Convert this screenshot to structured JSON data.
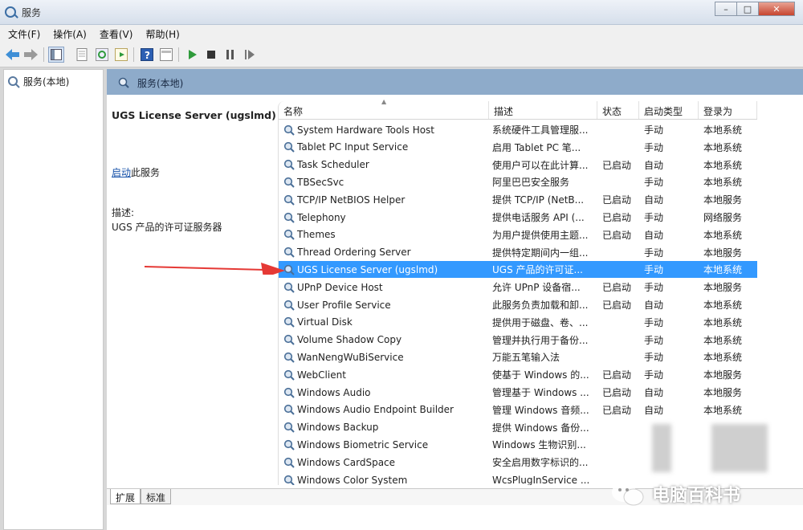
{
  "window": {
    "title": "服务"
  },
  "menu": [
    "文件(F)",
    "操作(A)",
    "查看(V)",
    "帮助(H)"
  ],
  "tree": {
    "root_label": "服务(本地)"
  },
  "panel": {
    "header": "服务(本地)"
  },
  "detail": {
    "service_name": "UGS License Server (ugslmd)",
    "start_link": "启动",
    "start_suffix": "此服务",
    "desc_label": "描述:",
    "desc_value": "UGS 产品的许可证服务器"
  },
  "columns": [
    "名称",
    "描述",
    "状态",
    "启动类型",
    "登录为"
  ],
  "services": [
    {
      "name": "System Hardware Tools Host",
      "desc": "系统硬件工具管理服...",
      "status": "",
      "startup": "手动",
      "logon": "本地系统"
    },
    {
      "name": "Tablet PC Input Service",
      "desc": "启用 Tablet PC 笔...",
      "status": "",
      "startup": "手动",
      "logon": "本地系统"
    },
    {
      "name": "Task Scheduler",
      "desc": "使用户可以在此计算...",
      "status": "已启动",
      "startup": "自动",
      "logon": "本地系统"
    },
    {
      "name": "TBSecSvc",
      "desc": "阿里巴巴安全服务",
      "status": "",
      "startup": "手动",
      "logon": "本地系统"
    },
    {
      "name": "TCP/IP NetBIOS Helper",
      "desc": "提供 TCP/IP (NetB...",
      "status": "已启动",
      "startup": "自动",
      "logon": "本地服务"
    },
    {
      "name": "Telephony",
      "desc": "提供电话服务 API (...",
      "status": "已启动",
      "startup": "手动",
      "logon": "网络服务"
    },
    {
      "name": "Themes",
      "desc": "为用户提供使用主题...",
      "status": "已启动",
      "startup": "自动",
      "logon": "本地系统"
    },
    {
      "name": "Thread Ordering Server",
      "desc": "提供特定期间内一组...",
      "status": "",
      "startup": "手动",
      "logon": "本地服务"
    },
    {
      "name": "UGS License Server (ugslmd)",
      "desc": "UGS 产品的许可证...",
      "status": "",
      "startup": "手动",
      "logon": "本地系统",
      "selected": true
    },
    {
      "name": "UPnP Device Host",
      "desc": "允许 UPnP 设备宿...",
      "status": "已启动",
      "startup": "手动",
      "logon": "本地服务"
    },
    {
      "name": "User Profile Service",
      "desc": "此服务负责加载和卸...",
      "status": "已启动",
      "startup": "自动",
      "logon": "本地系统"
    },
    {
      "name": "Virtual Disk",
      "desc": "提供用于磁盘、卷、...",
      "status": "",
      "startup": "手动",
      "logon": "本地系统"
    },
    {
      "name": "Volume Shadow Copy",
      "desc": "管理并执行用于备份...",
      "status": "",
      "startup": "手动",
      "logon": "本地系统"
    },
    {
      "name": "WanNengWuBiService",
      "desc": "万能五笔输入法",
      "status": "",
      "startup": "手动",
      "logon": "本地系统"
    },
    {
      "name": "WebClient",
      "desc": "使基于 Windows 的...",
      "status": "已启动",
      "startup": "手动",
      "logon": "本地服务"
    },
    {
      "name": "Windows Audio",
      "desc": "管理基于 Windows ...",
      "status": "已启动",
      "startup": "自动",
      "logon": "本地服务"
    },
    {
      "name": "Windows Audio Endpoint Builder",
      "desc": "管理 Windows 音频...",
      "status": "已启动",
      "startup": "自动",
      "logon": "本地系统"
    },
    {
      "name": "Windows Backup",
      "desc": "提供 Windows 备份...",
      "status": "",
      "startup": "",
      "logon": ""
    },
    {
      "name": "Windows Biometric Service",
      "desc": "Windows 生物识别...",
      "status": "",
      "startup": "",
      "logon": ""
    },
    {
      "name": "Windows CardSpace",
      "desc": "安全启用数字标识的...",
      "status": "",
      "startup": "",
      "logon": ""
    },
    {
      "name": "Windows Color System",
      "desc": "WcsPlugInService ...",
      "status": "",
      "startup": "",
      "logon": ""
    }
  ],
  "tabs": [
    "扩展",
    "标准"
  ],
  "watermark": "电脑百科书",
  "colors": {
    "selection": "#3399ff",
    "header_strip": "#8eabca",
    "arrow": "#e53935"
  }
}
